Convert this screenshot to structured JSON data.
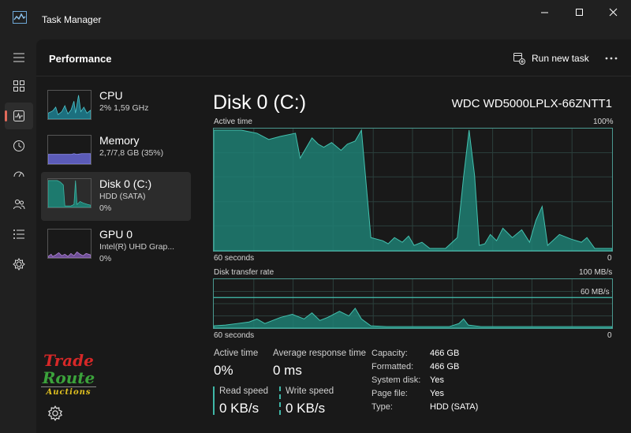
{
  "window": {
    "title": "Task Manager"
  },
  "header": {
    "title": "Performance",
    "run_new_task": "Run new task"
  },
  "rail": {
    "items": [
      {
        "name": "menu-icon"
      },
      {
        "name": "processes-icon"
      },
      {
        "name": "performance-icon"
      },
      {
        "name": "app-history-icon"
      },
      {
        "name": "startup-apps-icon"
      },
      {
        "name": "users-icon"
      },
      {
        "name": "details-icon"
      },
      {
        "name": "services-icon"
      }
    ],
    "settings": "settings-icon",
    "accent": "#e26a5a"
  },
  "cards": [
    {
      "title": "CPU",
      "line1": "2%  1,59 GHz",
      "line2": "",
      "color": "#4ec9d0"
    },
    {
      "title": "Memory",
      "line1": "2,7/7,8 GB (35%)",
      "line2": "",
      "color": "#8c8cf0"
    },
    {
      "title": "Disk 0 (C:)",
      "line1": "HDD (SATA)",
      "line2": "0%",
      "color": "#3fb8a8"
    },
    {
      "title": "GPU 0",
      "line1": "Intel(R) UHD Grap...",
      "line2": "0%",
      "color": "#b48ad8"
    }
  ],
  "logo": {
    "line1": "Trade",
    "line2": "Route",
    "line3": "Auctions"
  },
  "detail": {
    "title": "Disk 0 (C:)",
    "device": "WDC WD5000LPLX-66ZNTT1",
    "active_time_label": "Active time",
    "active_time_max": "100%",
    "axis_left": "60 seconds",
    "axis_right": "0",
    "transfer_label": "Disk transfer rate",
    "transfer_max": "100 MB/s",
    "transfer_line": "60 MB/s",
    "transfer_axis_left": "60 seconds",
    "transfer_axis_right": "0",
    "accent": "#3fb8a8"
  },
  "stats": {
    "active_time": {
      "label": "Active time",
      "value": "0%"
    },
    "avg_response": {
      "label": "Average response time",
      "value": "0 ms"
    },
    "read": {
      "label": "Read speed",
      "value": "0 KB/s"
    },
    "write": {
      "label": "Write speed",
      "value": "0 KB/s"
    }
  },
  "properties": [
    {
      "key": "Capacity:",
      "value": "466 GB"
    },
    {
      "key": "Formatted:",
      "value": "466 GB"
    },
    {
      "key": "System disk:",
      "value": "Yes"
    },
    {
      "key": "Page file:",
      "value": "Yes"
    },
    {
      "key": "Type:",
      "value": "HDD (SATA)"
    }
  ]
}
